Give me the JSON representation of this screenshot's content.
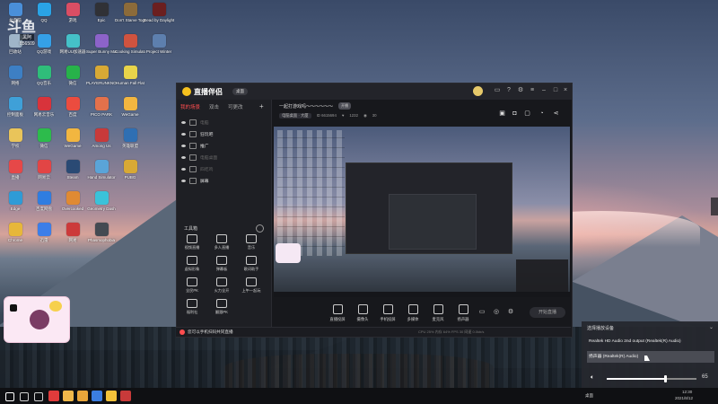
{
  "watermark": {
    "logo": "斗鱼",
    "name": "黑阿",
    "id": "856509"
  },
  "desktop_icons": [
    {
      "label": "此电脑",
      "color": "#4a8fd9"
    },
    {
      "label": "回收站",
      "color": "#9fb5c9"
    },
    {
      "label": "网络",
      "color": "#3d7fc4"
    },
    {
      "label": "控制面板",
      "color": "#3fa0d8"
    },
    {
      "label": "学校",
      "color": "#e9c45a"
    },
    {
      "label": "直播",
      "color": "#e64848"
    },
    {
      "label": "Edge",
      "color": "#2f9bd6"
    },
    {
      "label": "Chrome",
      "color": "#e7b73a"
    },
    {
      "label": "QQ",
      "color": "#2aa3e6"
    },
    {
      "label": "QQ游戏",
      "color": "#35a0e8"
    },
    {
      "label": "QQ音乐",
      "color": "#2fbd7a"
    },
    {
      "label": "网易云音乐",
      "color": "#d8333b"
    },
    {
      "label": "微信",
      "color": "#2dbb4c"
    },
    {
      "label": "网易云",
      "color": "#e24545"
    },
    {
      "label": "百度网盘",
      "color": "#2f7de0"
    },
    {
      "label": "迅雷",
      "color": "#3c7ee8"
    },
    {
      "label": "游戏",
      "color": "#d94e64"
    },
    {
      "label": "网易UU加速器",
      "color": "#45c0c8"
    },
    {
      "label": "微信",
      "color": "#27b24a"
    },
    {
      "label": "百度",
      "color": "#eb4c3f"
    },
    {
      "label": "WeGame",
      "color": "#f2b640"
    },
    {
      "label": "Steam",
      "color": "#2a4a74"
    },
    {
      "label": "Overcooked",
      "color": "#e08a33"
    },
    {
      "label": "网易",
      "color": "#cc3a3a"
    },
    {
      "label": "Epic",
      "color": "#303136"
    },
    {
      "label": "Super Bunny Man",
      "color": "#8c63c9"
    },
    {
      "label": "PLAYERUNKNOWN'S BATTLEGR",
      "color": "#d8a935"
    },
    {
      "label": "PICO PARK",
      "color": "#e3714b"
    },
    {
      "label": "Among Us",
      "color": "#c83a3a"
    },
    {
      "label": "Hand Simulator",
      "color": "#5aa4d8"
    },
    {
      "label": "Geometry Dash",
      "color": "#3ac2d9"
    },
    {
      "label": "Phasmophobia",
      "color": "#444a52"
    },
    {
      "label": "Don't Starve Together",
      "color": "#8c6b3a"
    },
    {
      "label": "Cooking Simulator",
      "color": "#d0533f"
    },
    {
      "label": "Human Fall Flat",
      "color": "#e8d44a"
    },
    {
      "label": "WeGame",
      "color": "#f2b640"
    },
    {
      "label": "英雄联盟",
      "color": "#2f6fb3"
    },
    {
      "label": "PUBG",
      "color": "#d8a935"
    },
    {
      "label": "Dead by Daylight",
      "color": "#6b1f1f"
    },
    {
      "label": "Project Winter",
      "color": "#5d7fae"
    }
  ],
  "app": {
    "brand": "直播伴侣",
    "brand_tag": "桌面",
    "room_title": "一起打游戏吗～～～～～～",
    "room_badge": "开播",
    "category": "电脑桌面 · 大厦",
    "room_id": "ID 6615694",
    "likes": "1232",
    "viewers": "30",
    "sidebar_tabs": [
      "我的场景",
      "双击",
      "可更改"
    ],
    "layers": [
      {
        "name": "电脑",
        "dim": true
      },
      {
        "name": "狂玩吧",
        "dim": false
      },
      {
        "name": "推广",
        "dim": false
      },
      {
        "name": "电脑桌面",
        "dim": true
      },
      {
        "name": "四吃鸡",
        "dim": true
      },
      {
        "name": "屏幕",
        "dim": false
      }
    ],
    "tools_header": "工具箱",
    "tools": [
      "视频直播",
      "多人直播",
      "音乐",
      "虚拟形象",
      "弹幕板",
      "歌词助手",
      "全民PK",
      "火力全开",
      "上午一起玩",
      "福利社",
      "翻跟PK"
    ],
    "bottom_actions": [
      "直播投屏",
      "摄像头",
      "手机投屏",
      "多媒体",
      "麦克风",
      "扬声器"
    ],
    "start_button": "开始直播",
    "notice": "您可以手机扫码共同直播",
    "stats": "CPU 25%  内存 64%  FPS 30  网速 0.0kb/s"
  },
  "audio_flyout": {
    "header": "选择播放设备",
    "devices": [
      {
        "name": "Realtek HD Audio 2nd output (Realtek(R) Audio)",
        "selected": false
      },
      {
        "name": "扬声器 (Realtek(R) Audio)",
        "selected": true
      }
    ],
    "volume": 65
  },
  "taskbar": {
    "apps": [
      {
        "name": "start",
        "color": "#ffffff"
      },
      {
        "name": "search",
        "color": "#cfcfcf"
      },
      {
        "name": "task-view",
        "color": "#cfcfcf"
      },
      {
        "name": "app1",
        "color": "#e03b3b"
      },
      {
        "name": "app2",
        "color": "#f0b84a"
      },
      {
        "name": "app3",
        "color": "#e8a53a"
      },
      {
        "name": "app4",
        "color": "#3b7de0"
      },
      {
        "name": "app5",
        "color": "#f2c23a"
      },
      {
        "name": "app6",
        "color": "#c83a3a"
      }
    ],
    "tray_label": "桌面",
    "time": "12:30",
    "date": "2021/8/12"
  }
}
